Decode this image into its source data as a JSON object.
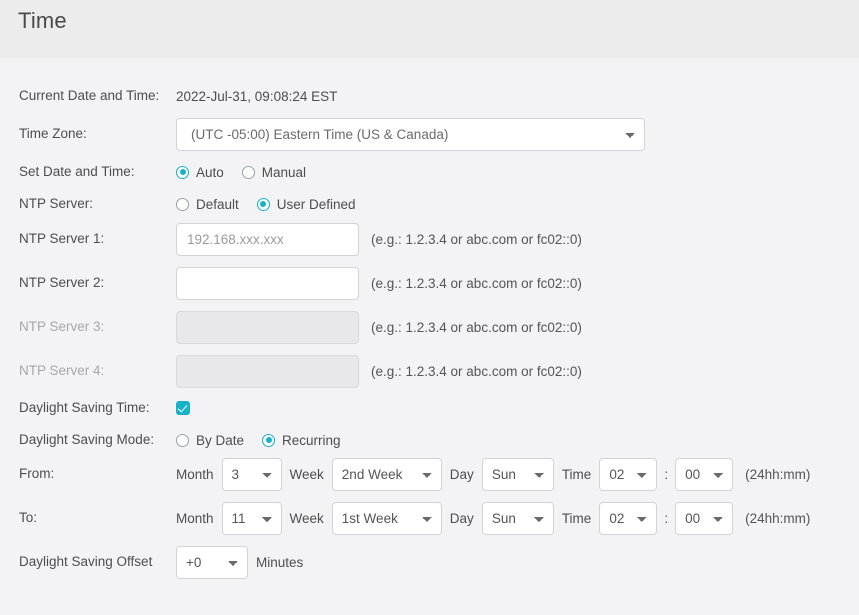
{
  "header": {
    "title": "Time"
  },
  "fields": {
    "current_datetime": {
      "label": "Current Date and Time:",
      "value": "2022-Jul-31, 09:08:24 EST"
    },
    "time_zone": {
      "label": "Time Zone:",
      "value": "(UTC -05:00) Eastern Time (US & Canada)"
    },
    "set_date_time": {
      "label": "Set Date and Time:",
      "options": [
        "Auto",
        "Manual"
      ],
      "selected": "Auto"
    },
    "ntp_server_mode": {
      "label": "NTP Server:",
      "options": [
        "Default",
        "User Defined"
      ],
      "selected": "User Defined"
    },
    "ntp_servers": [
      {
        "label": "NTP Server 1:",
        "value": "",
        "placeholder": "192.168.xxx.xxx",
        "hint": "(e.g.: 1.2.3.4 or abc.com or fc02::0)",
        "disabled": false
      },
      {
        "label": "NTP Server 2:",
        "value": "",
        "placeholder": "",
        "hint": "(e.g.: 1.2.3.4 or abc.com or fc02::0)",
        "disabled": false
      },
      {
        "label": "NTP Server 3:",
        "value": "",
        "placeholder": "",
        "hint": "(e.g.: 1.2.3.4 or abc.com or fc02::0)",
        "disabled": true
      },
      {
        "label": "NTP Server 4:",
        "value": "",
        "placeholder": "",
        "hint": "(e.g.: 1.2.3.4 or abc.com or fc02::0)",
        "disabled": true
      }
    ],
    "daylight_saving_time": {
      "label": "Daylight Saving Time:",
      "checked": true
    },
    "daylight_saving_mode": {
      "label": "Daylight Saving Mode:",
      "options": [
        "By Date",
        "Recurring"
      ],
      "selected": "Recurring"
    },
    "from": {
      "label": "From:",
      "month_label": "Month",
      "month_value": "3",
      "week_label": "Week",
      "week_value": "2nd Week",
      "day_label": "Day",
      "day_value": "Sun",
      "time_label": "Time",
      "hour_value": "02",
      "separator": ":",
      "minute_value": "00",
      "hint": "(24hh:mm)"
    },
    "to": {
      "label": "To:",
      "month_label": "Month",
      "month_value": "11",
      "week_label": "Week",
      "week_value": "1st Week",
      "day_label": "Day",
      "day_value": "Sun",
      "time_label": "Time",
      "hour_value": "02",
      "separator": ":",
      "minute_value": "00",
      "hint": "(24hh:mm)"
    },
    "daylight_saving_offset": {
      "label": "Daylight Saving Offset",
      "value": "+0",
      "unit": "Minutes"
    }
  },
  "colors": {
    "accent": "#15b2c9",
    "header_bg": "#ececec",
    "body_bg": "#f3f3f5",
    "text": "#4d4d4d",
    "dim_text": "#a7a7a7"
  }
}
